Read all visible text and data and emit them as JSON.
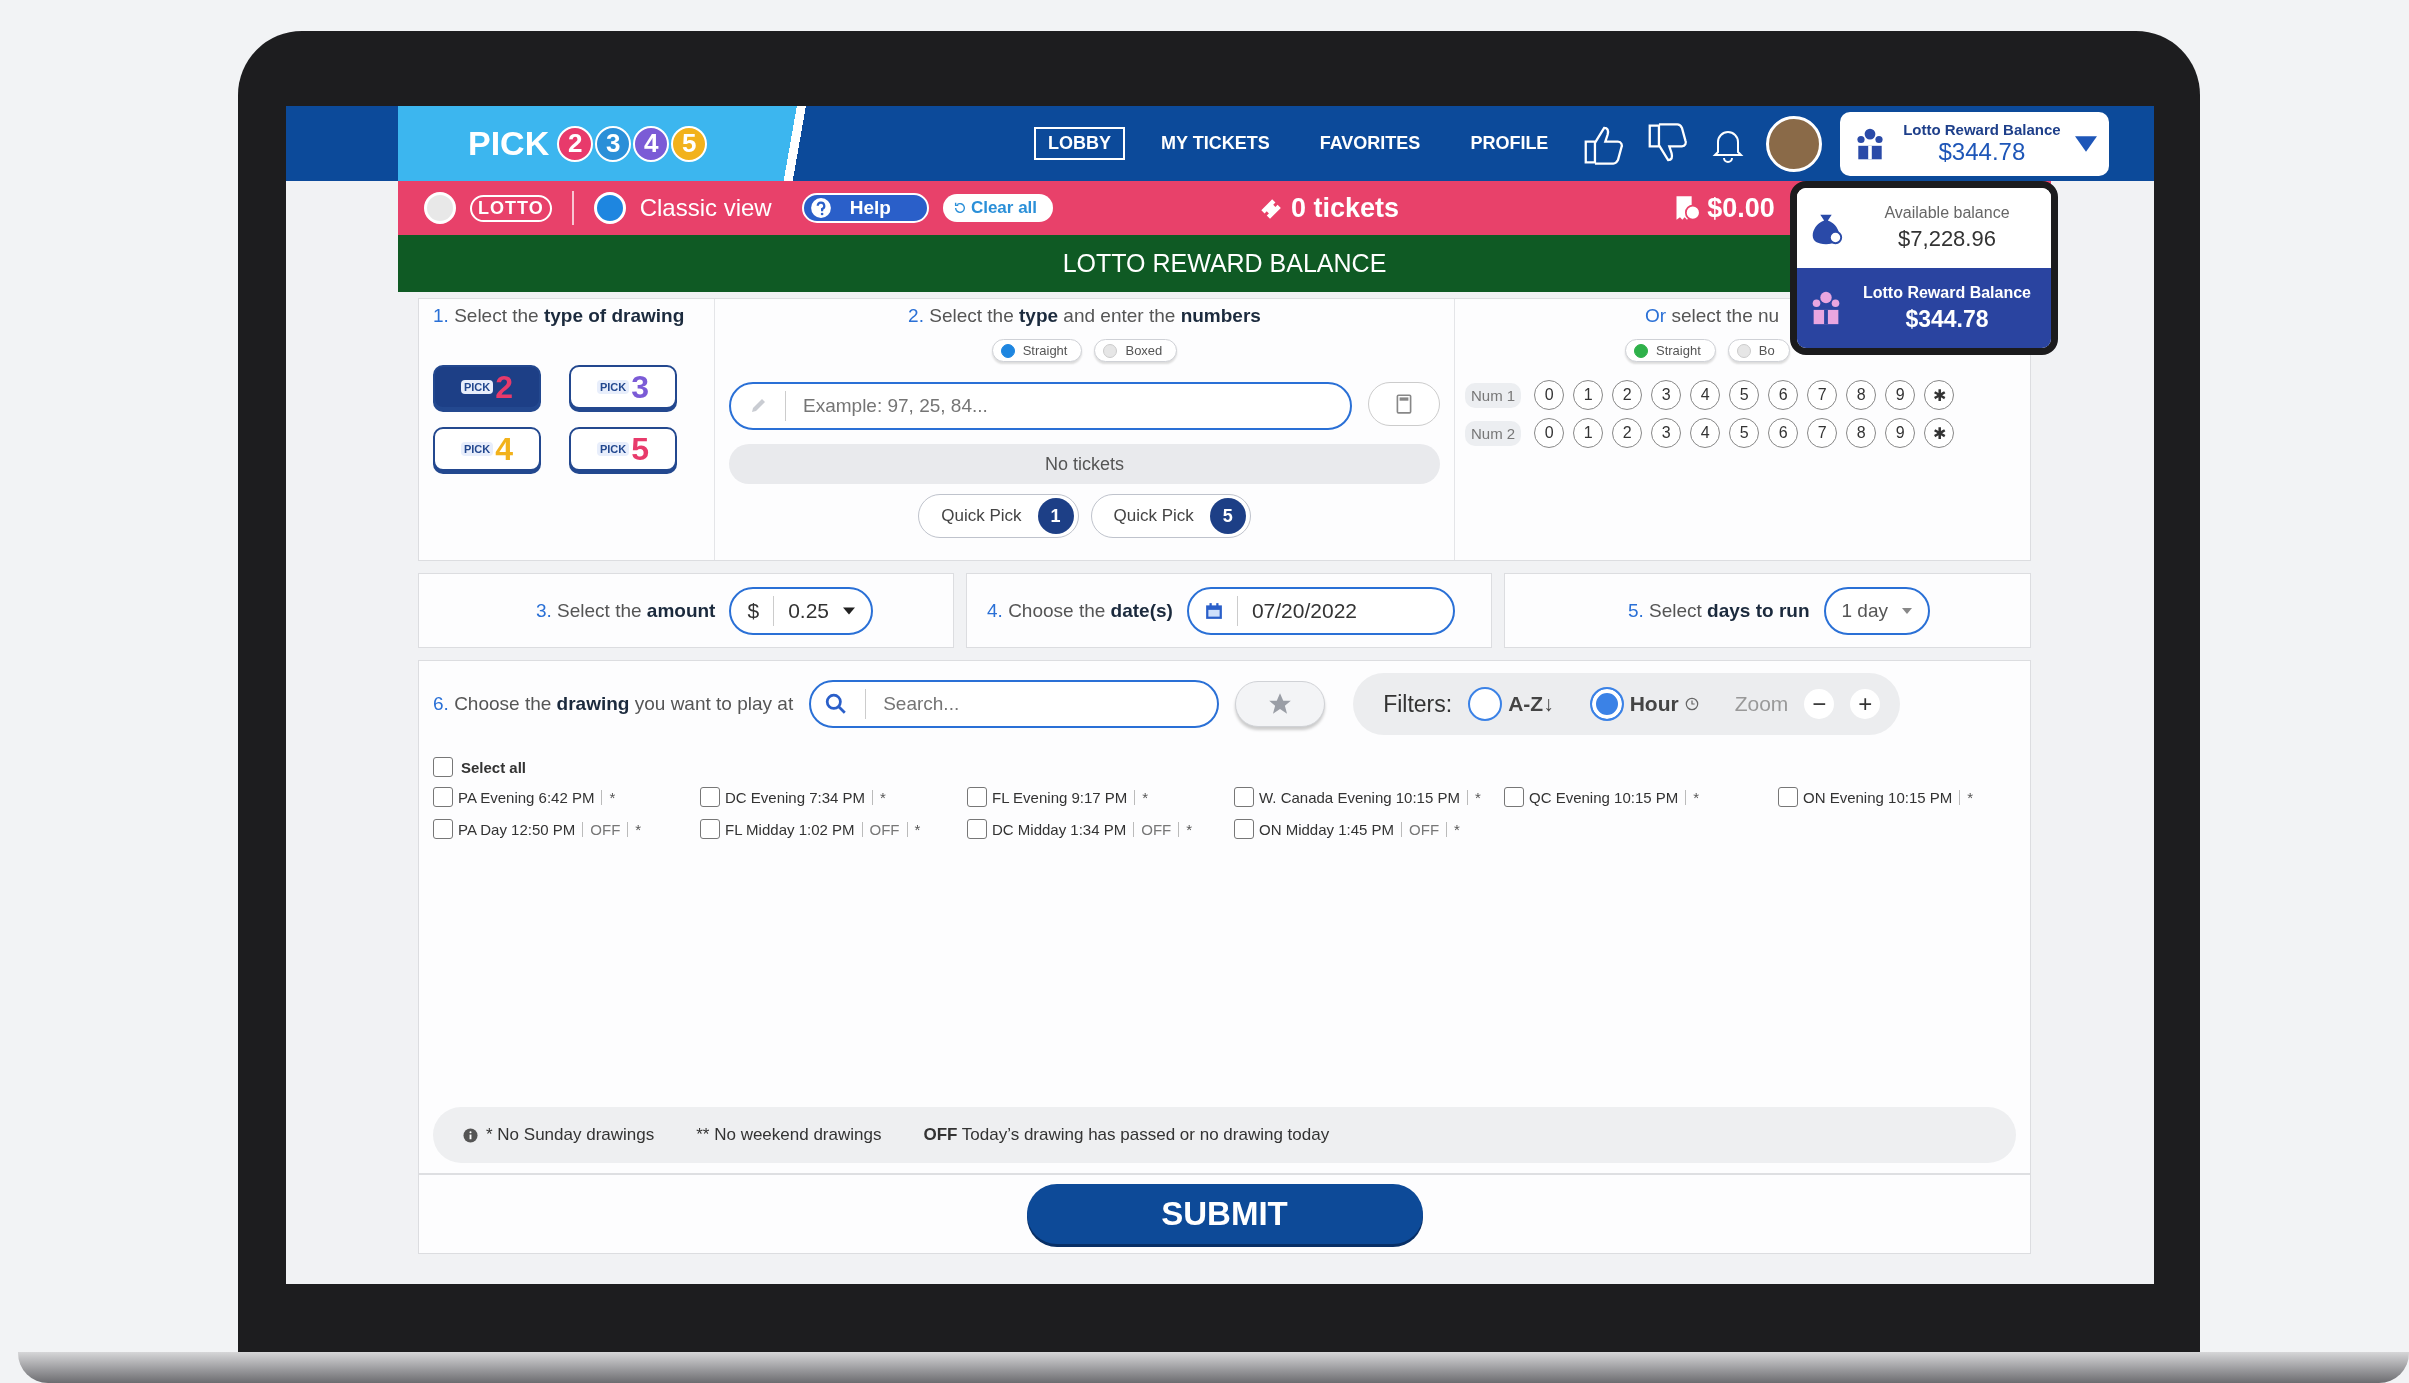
{
  "header": {
    "logo": {
      "word": "PICK",
      "balls": [
        "2",
        "3",
        "4",
        "5"
      ]
    },
    "nav": [
      {
        "label": "LOBBY",
        "selected": true
      },
      {
        "label": "MY TICKETS",
        "selected": false
      },
      {
        "label": "FAVORITES",
        "selected": false
      },
      {
        "label": "PROFILE",
        "selected": false
      }
    ],
    "balance_button": {
      "label": "Lotto Reward Balance",
      "amount": "$344.78"
    }
  },
  "toolbar": {
    "modes": [
      {
        "kind": "logo",
        "label": "LOTTO",
        "selected": false
      },
      {
        "kind": "text",
        "label": "Classic view",
        "selected": true
      }
    ],
    "help": "Help",
    "clear": "Clear all",
    "tickets": "0 tickets",
    "total": "$0.00"
  },
  "balance_menu": [
    {
      "label": "Available balance",
      "amount": "$7,228.96",
      "selected": false
    },
    {
      "label": "Lotto Reward Balance",
      "amount": "$344.78",
      "selected": true
    }
  ],
  "banner": "LOTTO REWARD BALANCE",
  "step1": {
    "num": "1.",
    "text": "Select the **type of drawing**",
    "games": [
      {
        "word": "PICK",
        "digit": "2",
        "selected": true
      },
      {
        "word": "PICK",
        "digit": "3",
        "selected": false
      },
      {
        "word": "PICK",
        "digit": "4",
        "selected": false
      },
      {
        "word": "PICK",
        "digit": "5",
        "selected": false
      }
    ]
  },
  "step2": {
    "num": "2.",
    "text": "Select the **type** and enter the **numbers**",
    "types": [
      {
        "label": "Straight",
        "selected": true
      },
      {
        "label": "Boxed",
        "selected": false
      }
    ],
    "placeholder": "Example: 97, 25, 84...",
    "empty": "No tickets",
    "quick_picks": [
      {
        "label": "Quick Pick",
        "count": "1"
      },
      {
        "label": "Quick Pick",
        "count": "5"
      }
    ]
  },
  "step2b": {
    "num": "Or",
    "text": "select the nu",
    "types": [
      {
        "label": "Straight",
        "selected": true
      },
      {
        "label": "Bo",
        "selected": false
      }
    ],
    "rows": [
      {
        "label": "Num 1",
        "balls": [
          "0",
          "1",
          "2",
          "3",
          "4",
          "5",
          "6",
          "7",
          "8",
          "9",
          "✱"
        ]
      },
      {
        "label": "Num 2",
        "balls": [
          "0",
          "1",
          "2",
          "3",
          "4",
          "5",
          "6",
          "7",
          "8",
          "9",
          "✱"
        ]
      }
    ]
  },
  "step3": {
    "num": "3.",
    "text": "Select the **amount**",
    "currency": "$",
    "value": "0.25"
  },
  "step4": {
    "num": "4.",
    "text": "Choose the **date(s)**",
    "value": "07/20/2022"
  },
  "step5": {
    "num": "5.",
    "text": "Select **days to run**",
    "value": "1 day"
  },
  "step6": {
    "num": "6.",
    "text": "Choose the **drawing** you want to play at",
    "placeholder": "Search...",
    "filters_label": "Filters:",
    "sorts": [
      {
        "label": "A-Z↓",
        "selected": false
      },
      {
        "label": "Hour",
        "selected": true
      }
    ],
    "zoom_label": "Zoom",
    "zoom_out": "−",
    "zoom_in": "+"
  },
  "drawings": {
    "select_all": {
      "label": "Select all",
      "checked": false
    },
    "rows": [
      [
        {
          "name": "PA Evening 6:42 PM",
          "mark": "*",
          "checked": false
        },
        {
          "name": "DC Evening 7:34 PM",
          "mark": "*",
          "checked": false
        },
        {
          "name": "FL Evening 9:17 PM",
          "mark": "*",
          "checked": false
        },
        {
          "name": "W. Canada Evening 10:15 PM",
          "mark": "*",
          "checked": false
        },
        {
          "name": "QC Evening 10:15 PM",
          "mark": "*",
          "checked": false
        },
        {
          "name": "ON Evening 10:15 PM",
          "mark": "*",
          "checked": false
        }
      ],
      [
        {
          "name": "PA Day 12:50 PM",
          "status": "OFF",
          "mark": "*",
          "checked": false
        },
        {
          "name": "FL Midday 1:02 PM",
          "status": "OFF",
          "mark": "*",
          "checked": false
        },
        {
          "name": "DC Midday 1:34 PM",
          "status": "OFF",
          "mark": "*",
          "checked": false
        },
        {
          "name": "ON Midday 1:45 PM",
          "status": "OFF",
          "mark": "*",
          "checked": false
        }
      ]
    ]
  },
  "legend": [
    "* No Sunday drawings",
    "** No weekend drawings",
    "**OFF** Today’s drawing has passed or no drawing today"
  ],
  "submit": "SUBMIT"
}
